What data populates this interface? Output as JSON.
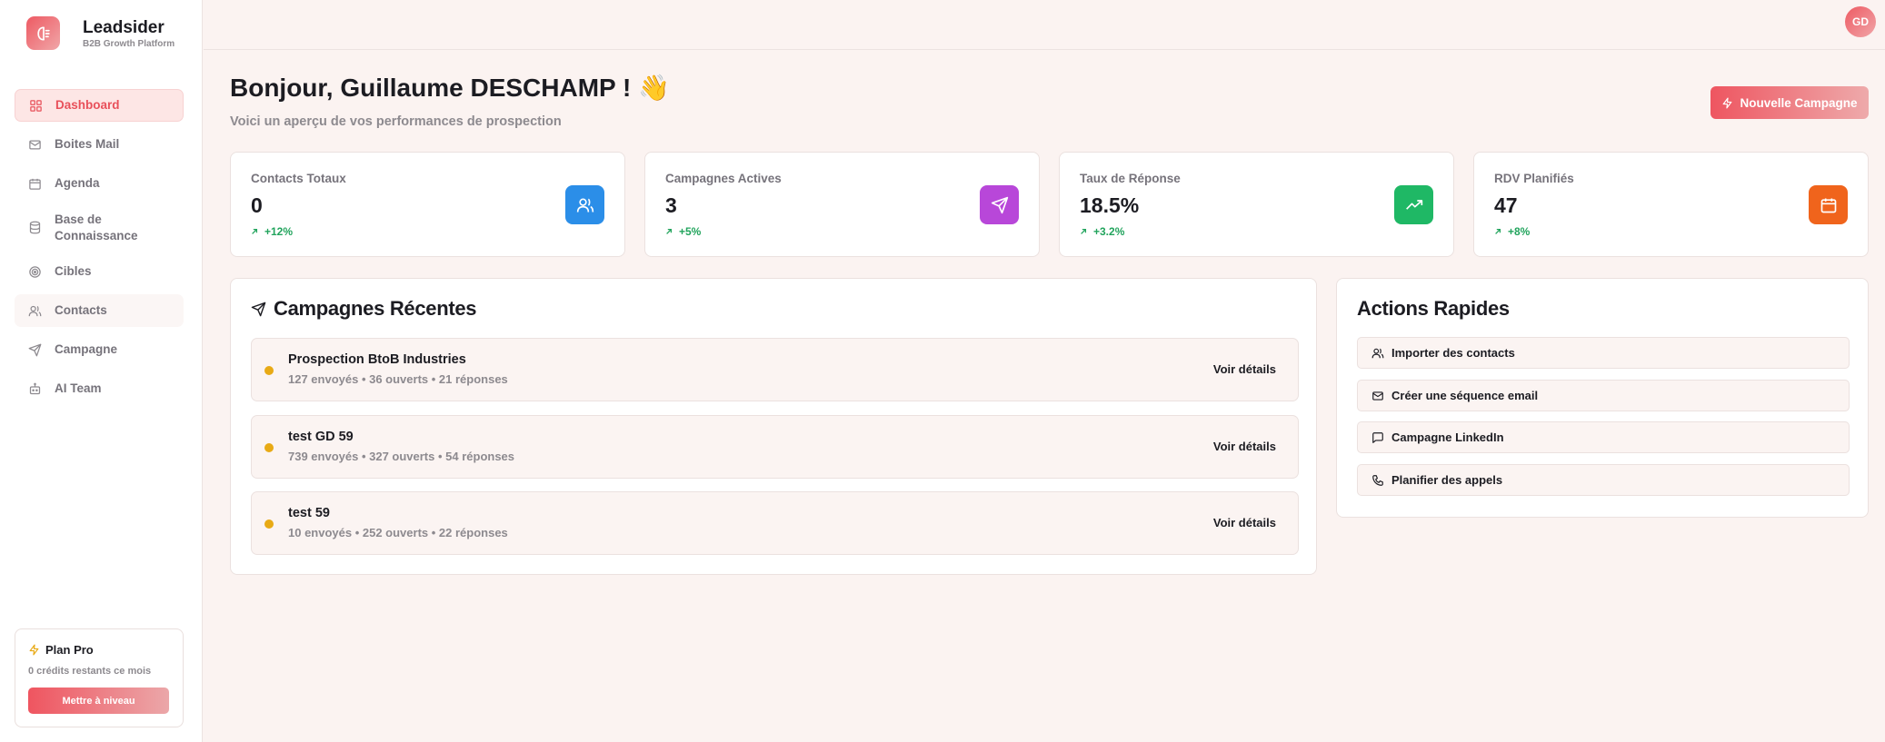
{
  "brand": {
    "name": "Leadsider",
    "tagline": "B2B Growth Platform"
  },
  "sidebar": {
    "items": [
      {
        "label": "Dashboard",
        "icon": "dashboard-grid-icon",
        "active": true
      },
      {
        "label": "Boites Mail",
        "icon": "mail-icon"
      },
      {
        "label": "Agenda",
        "icon": "calendar-icon"
      },
      {
        "label": "Base de Connaissance",
        "icon": "database-icon"
      },
      {
        "label": "Cibles",
        "icon": "target-icon"
      },
      {
        "label": "Contacts",
        "icon": "users-icon"
      },
      {
        "label": "Campagne",
        "icon": "send-icon"
      },
      {
        "label": "AI Team",
        "icon": "bot-icon"
      }
    ],
    "plan": {
      "title": "Plan Pro",
      "subtitle": "0 crédits restants ce mois",
      "button": "Mettre à niveau"
    }
  },
  "header": {
    "avatar_initials": "GD"
  },
  "main": {
    "greeting": "Bonjour, Guillaume DESCHAMP ! 👋",
    "subtitle": "Voici un aperçu de vos performances de prospection",
    "new_campaign_button": "Nouvelle Campagne",
    "stats": [
      {
        "label": "Contacts Totaux",
        "value": "0",
        "delta": "+12%",
        "icon": "users-icon",
        "color": "#2b8ee8"
      },
      {
        "label": "Campagnes Actives",
        "value": "3",
        "delta": "+5%",
        "icon": "send-icon",
        "color": "#b847d9"
      },
      {
        "label": "Taux de Réponse",
        "value": "18.5%",
        "delta": "+3.2%",
        "icon": "trending-up-icon",
        "color": "#1fb865"
      },
      {
        "label": "RDV Planifiés",
        "value": "47",
        "delta": "+8%",
        "icon": "calendar-icon",
        "color": "#f0641c"
      }
    ],
    "recent_campaigns": {
      "title": "Campagnes Récentes",
      "items": [
        {
          "name": "Prospection BtoB Industries",
          "stats": "127 envoyés • 36 ouverts • 21 réponses",
          "action": "Voir détails"
        },
        {
          "name": "test GD 59",
          "stats": "739 envoyés • 327 ouverts • 54 réponses",
          "action": "Voir détails"
        },
        {
          "name": "test 59",
          "stats": "10 envoyés • 252 ouverts • 22 réponses",
          "action": "Voir détails"
        }
      ]
    },
    "quick_actions": {
      "title": "Actions Rapides",
      "items": [
        {
          "label": "Importer des contacts",
          "icon": "users-icon"
        },
        {
          "label": "Créer une séquence email",
          "icon": "mail-icon"
        },
        {
          "label": "Campagne LinkedIn",
          "icon": "message-icon"
        },
        {
          "label": "Planifier des appels",
          "icon": "phone-icon"
        }
      ]
    }
  }
}
